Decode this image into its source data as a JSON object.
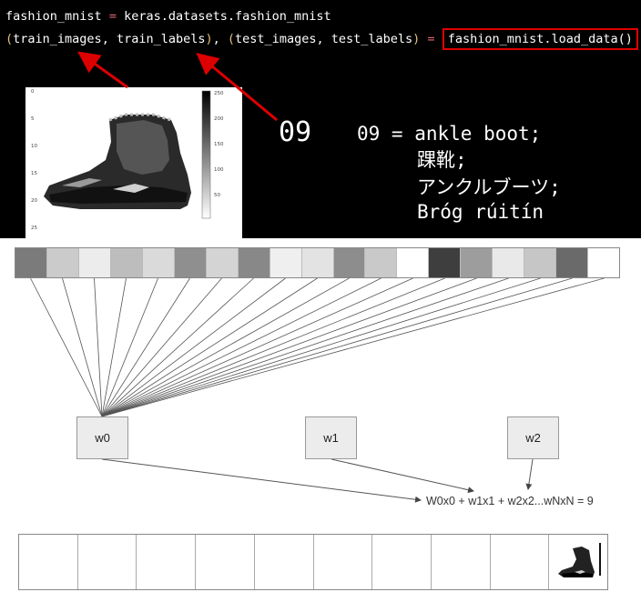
{
  "code": {
    "line1": {
      "var": "fashion_mnist",
      "op": "=",
      "rhs": "keras.datasets.fashion_mnist"
    },
    "line2": {
      "lparen1": "(",
      "train_images": "train_images",
      "comma1": ", ",
      "train_labels": "train_labels",
      "rparen1": ")",
      "comma_mid": ", ",
      "lparen2": "(",
      "test_images": "test_images",
      "comma2": ", ",
      "test_labels": "test_labels",
      "rparen2": ")",
      "op": "=",
      "call": "fashion_mnist.load_data()"
    }
  },
  "plot": {
    "y_ticks": [
      "0",
      "5",
      "10",
      "15",
      "20",
      "25"
    ],
    "colorbar_ticks": [
      "250",
      "200",
      "150",
      "100",
      "50"
    ]
  },
  "label_value": "09",
  "definitions": {
    "line1": "09 = ankle boot;",
    "line2": "踝靴;",
    "line3": "アンクルブーツ;",
    "line4": "Bróg rúitín"
  },
  "pixel_strip_colors": [
    "#7b7b7b",
    "#cbcbcb",
    "#ececec",
    "#bdbdbd",
    "#dadada",
    "#8f8f8f",
    "#d4d4d4",
    "#888888",
    "#efefef",
    "#e3e3e3",
    "#8d8d8d",
    "#c9c9c9",
    "#ffffff",
    "#3e3e3e",
    "#9d9d9d",
    "#e9e9e9",
    "#c6c6c6",
    "#6a6a6a",
    "#ffffff"
  ],
  "weights": [
    "w0",
    "w1",
    "w2"
  ],
  "formula": "W0x0 + w1x1 + w2x2...wNxN = 9",
  "output_cells": 10,
  "colors": {
    "code_background": "#000000",
    "highlight_box": "#e00000",
    "arrow": "#dd0000"
  }
}
